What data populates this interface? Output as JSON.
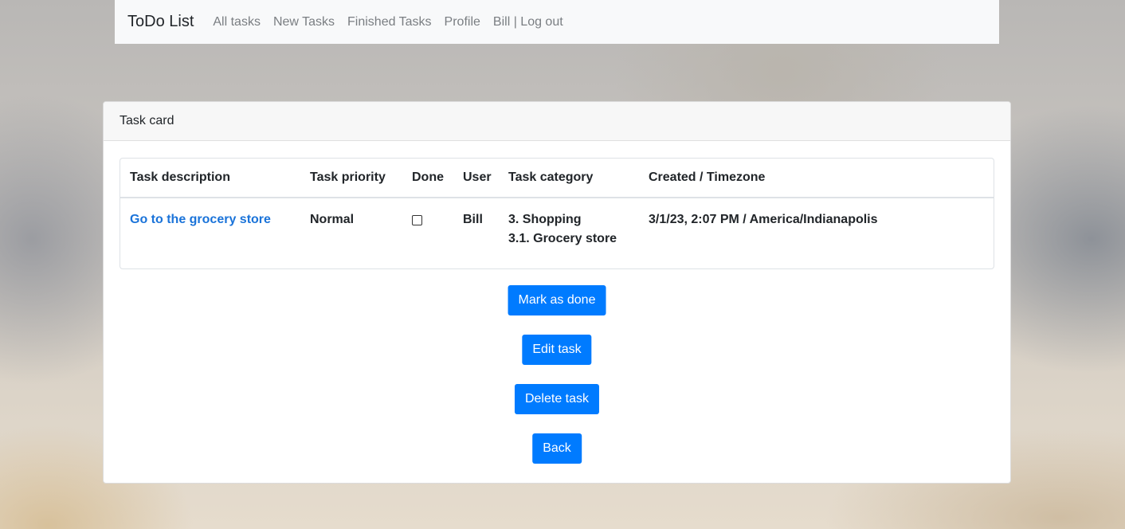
{
  "navbar": {
    "brand": "ToDo List",
    "links": [
      "All tasks",
      "New Tasks",
      "Finished Tasks",
      "Profile",
      "Bill | Log out"
    ]
  },
  "card": {
    "header": "Task card",
    "table": {
      "columns": [
        "Task description",
        "Task priority",
        "Done",
        "User",
        "Task category",
        "Created / Timezone"
      ],
      "row": {
        "description": "Go to the grocery store",
        "priority": "Normal",
        "done": false,
        "user": "Bill",
        "category_1": "3. Shopping",
        "category_2": "3.1. Grocery store",
        "created": "3/1/23, 2:07 PM / America/Indianapolis"
      }
    },
    "buttons": {
      "mark_done": "Mark as done",
      "edit": "Edit task",
      "delete": "Delete task",
      "back": "Back"
    }
  },
  "colors": {
    "primary": "#007bff",
    "link": "#1a73d9",
    "navbar_bg": "#f8f9fa"
  }
}
